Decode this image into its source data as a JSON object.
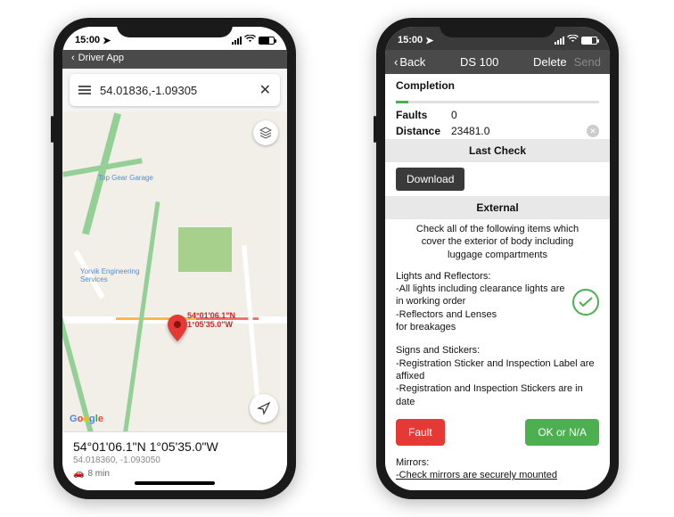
{
  "phone1": {
    "status_time": "15:00",
    "app_header": "Driver App",
    "search_value": "54.01836,-1.09305",
    "layers_icon": "layers-icon",
    "pin_line1": "54°01'06.1\"N",
    "pin_line2": "1°05'35.0\"W",
    "google": "Google",
    "poi_topgear": "Top Gear Garage",
    "poi_yorvik": "Yorvik Engineering\nServices",
    "bottom_coord": "54°01'06.1\"N 1°05'35.0\"W",
    "bottom_sub": "54.018360, -1.093050",
    "eta": "8 min"
  },
  "phone2": {
    "status_time": "15:00",
    "nav_back": "Back",
    "nav_title": "DS 100",
    "nav_delete": "Delete",
    "nav_send": "Send",
    "completion_label": "Completion",
    "faults_label": "Faults",
    "faults_value": "0",
    "distance_label": "Distance",
    "distance_value": "23481.0",
    "lastcheck_header": "Last Check",
    "download_btn": "Download",
    "external_header": "External",
    "external_desc": "Check all of the following items which cover the exterior of body including luggage compartments",
    "item1_title": "Lights and Reflectors:",
    "item1_l1": "-All lights including clearance lights are in working order",
    "item1_l2": "-Reflectors and Lenses",
    "item1_l3": "for breakages",
    "item2_title": "Signs and Stickers:",
    "item2_l1": "-Registration Sticker and Inspection Label are affixed",
    "item2_l2": "-Registration and Inspection Stickers are in date",
    "fault_btn": "Fault",
    "ok_btn": "OK or N/A",
    "item3_title": "Mirrors:",
    "item3_l1": "-Check mirrors are securely mounted"
  }
}
